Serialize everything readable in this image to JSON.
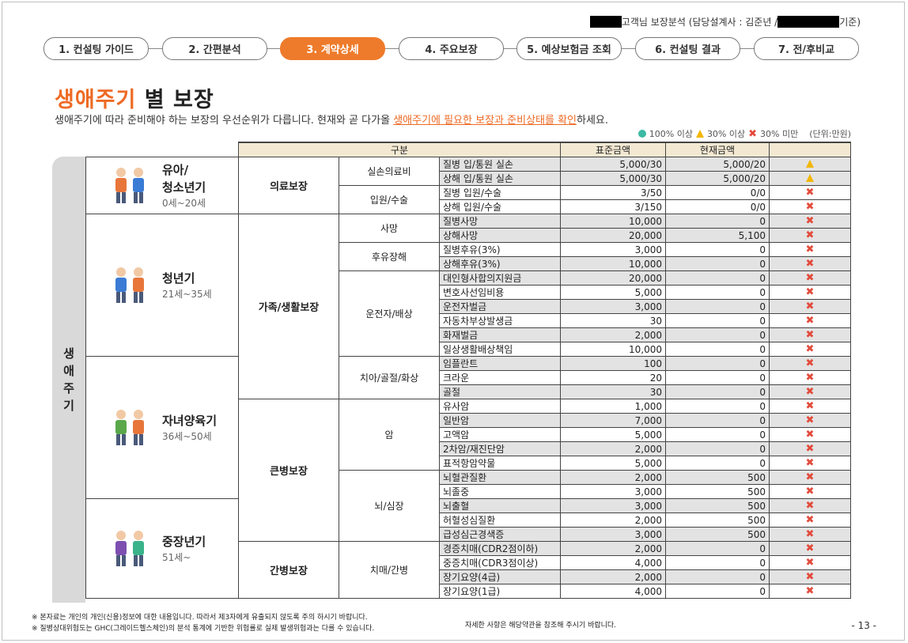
{
  "header": {
    "text": "고객님 보장분석 (담당설계사 : 김준년 /",
    "suffix": "기준)"
  },
  "steps": [
    "1. 컨설팅 가이드",
    "2. 간편분석",
    "3. 계약상세",
    "4. 주요보장",
    "5. 예상보험금 조회",
    "6. 컨설팅 결과",
    "7. 전/후비교"
  ],
  "active_step": 2,
  "title": {
    "highlight": "생애주기",
    "rest": " 별 보장"
  },
  "subtitle": {
    "pre": "생애주기에 따라 준비해야 하는 보장의 우선순위가 다릅니다. 현재와 곧 다가올 ",
    "highlight": "생애주기에 필요한 보장과 준비상태를 확인",
    "post": "하세요."
  },
  "legend": {
    "full": "100% 이상",
    "partial": "30% 이상",
    "low": "30% 미만",
    "unit": "(단위:만원)"
  },
  "colors": {
    "accent": "#ee7b2b",
    "ok": "#3bb9a3",
    "warn": "#f2b705",
    "bad": "#e34b3b"
  },
  "sidebar_label": "생애주기",
  "table": {
    "headers": {
      "category": "구분",
      "standard": "표준금액",
      "current": "현재금액"
    },
    "stages": [
      {
        "name1": "유아/",
        "name2": "청소년기",
        "age": "0세~20세"
      },
      {
        "name1": "청년기",
        "name2": "",
        "age": "21세~35세"
      },
      {
        "name1": "자녀양육기",
        "name2": "",
        "age": "36세~50세"
      },
      {
        "name1": "중장년기",
        "name2": "",
        "age": "51세~"
      }
    ],
    "categories": [
      "의료보장",
      "가족/생활보장",
      "큰병보장",
      "간병보장"
    ],
    "subcategories": [
      "실손의료비",
      "입원/수술",
      "사망",
      "후유장해",
      "운전자/배상",
      "치아/골절/화상",
      "암",
      "뇌/심장",
      "치매/간병"
    ],
    "rows": [
      {
        "item": "질병 입/통원 실손",
        "standard": "5,000/30",
        "current": "5,000/20",
        "status": "warn"
      },
      {
        "item": "상해 입/통원 실손",
        "standard": "5,000/30",
        "current": "5,000/20",
        "status": "warn"
      },
      {
        "item": "질병 입원/수술",
        "standard": "3/50",
        "current": "0/0",
        "status": "bad"
      },
      {
        "item": "상해 입원/수술",
        "standard": "3/150",
        "current": "0/0",
        "status": "bad"
      },
      {
        "item": "질병사망",
        "standard": "10,000",
        "current": "0",
        "status": "bad"
      },
      {
        "item": "상해사망",
        "standard": "20,000",
        "current": "5,100",
        "status": "bad"
      },
      {
        "item": "질병후유(3%)",
        "standard": "3,000",
        "current": "0",
        "status": "bad"
      },
      {
        "item": "상해후유(3%)",
        "standard": "10,000",
        "current": "0",
        "status": "bad"
      },
      {
        "item": "대인형사합의지원금",
        "standard": "20,000",
        "current": "0",
        "status": "bad"
      },
      {
        "item": "변호사선임비용",
        "standard": "5,000",
        "current": "0",
        "status": "bad"
      },
      {
        "item": "운전자벌금",
        "standard": "3,000",
        "current": "0",
        "status": "bad"
      },
      {
        "item": "자동차부상발생금",
        "standard": "30",
        "current": "0",
        "status": "bad"
      },
      {
        "item": "화재벌금",
        "standard": "2,000",
        "current": "0",
        "status": "bad"
      },
      {
        "item": "일상생활배상책임",
        "standard": "10,000",
        "current": "0",
        "status": "bad"
      },
      {
        "item": "임플란트",
        "standard": "100",
        "current": "0",
        "status": "bad"
      },
      {
        "item": "크라운",
        "standard": "20",
        "current": "0",
        "status": "bad"
      },
      {
        "item": "골절",
        "standard": "30",
        "current": "0",
        "status": "bad"
      },
      {
        "item": "유사암",
        "standard": "1,000",
        "current": "0",
        "status": "bad"
      },
      {
        "item": "일반암",
        "standard": "7,000",
        "current": "0",
        "status": "bad"
      },
      {
        "item": "고액암",
        "standard": "5,000",
        "current": "0",
        "status": "bad"
      },
      {
        "item": "2차암/재진단암",
        "standard": "2,000",
        "current": "0",
        "status": "bad"
      },
      {
        "item": "표적항암약물",
        "standard": "5,000",
        "current": "0",
        "status": "bad"
      },
      {
        "item": "뇌혈관질환",
        "standard": "2,000",
        "current": "500",
        "status": "bad"
      },
      {
        "item": "뇌졸중",
        "standard": "3,000",
        "current": "500",
        "status": "bad"
      },
      {
        "item": "뇌출혈",
        "standard": "3,000",
        "current": "500",
        "status": "bad"
      },
      {
        "item": "허혈성심질환",
        "standard": "2,000",
        "current": "500",
        "status": "bad"
      },
      {
        "item": "급성심근경색증",
        "standard": "3,000",
        "current": "500",
        "status": "bad"
      },
      {
        "item": "경증치매(CDR2점이하)",
        "standard": "2,000",
        "current": "0",
        "status": "bad"
      },
      {
        "item": "중증치매(CDR3점이상)",
        "standard": "4,000",
        "current": "0",
        "status": "bad"
      },
      {
        "item": "장기요양(4급)",
        "standard": "2,000",
        "current": "0",
        "status": "bad"
      },
      {
        "item": "장기요양(1급)",
        "standard": "4,000",
        "current": "0",
        "status": "bad"
      }
    ]
  },
  "footer": {
    "note1": "※ 본자료는 개인의 개인(신용)정보에 대한 내용입니다.  따라서 제3자에게 유출되지 않도록 주의 하시기 바랍니다.",
    "note2": "※ 질병상대위험도는 GHC(그레이드헬스체인)의 분석 통계에 기반한 위험률로 실제 발생위험과는 다를 수 있습니다.",
    "note3": "자세한 사항은 해당약관을 참조해 주시기 바랍니다.",
    "page": "- 13 -"
  }
}
